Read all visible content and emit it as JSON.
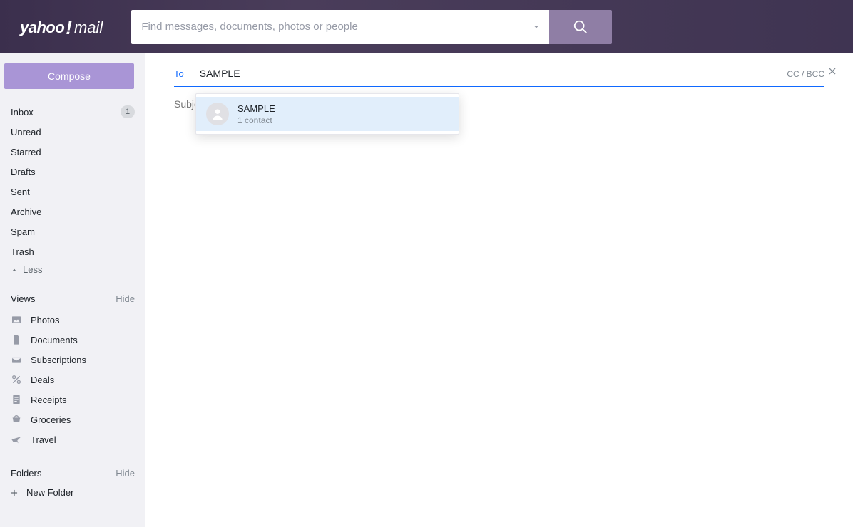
{
  "header": {
    "logo_yahoo": "yahoo",
    "logo_bang": "!",
    "logo_mail": "mail",
    "search_placeholder": "Find messages, documents, photos or people"
  },
  "sidebar": {
    "compose_label": "Compose",
    "folders": [
      {
        "label": "Inbox",
        "badge": "1"
      },
      {
        "label": "Unread"
      },
      {
        "label": "Starred"
      },
      {
        "label": "Drafts"
      },
      {
        "label": "Sent"
      },
      {
        "label": "Archive"
      },
      {
        "label": "Spam"
      },
      {
        "label": "Trash"
      }
    ],
    "less_label": "Less",
    "views_header": "Views",
    "views_hide": "Hide",
    "views": [
      {
        "label": "Photos",
        "icon": "photo-icon"
      },
      {
        "label": "Documents",
        "icon": "document-icon"
      },
      {
        "label": "Subscriptions",
        "icon": "subscriptions-icon"
      },
      {
        "label": "Deals",
        "icon": "deals-icon"
      },
      {
        "label": "Receipts",
        "icon": "receipts-icon"
      },
      {
        "label": "Groceries",
        "icon": "groceries-icon"
      },
      {
        "label": "Travel",
        "icon": "travel-icon"
      }
    ],
    "folders_header": "Folders",
    "folders_hide": "Hide",
    "new_folder_label": "New Folder"
  },
  "compose": {
    "to_label": "To",
    "to_value": "SAMPLE",
    "ccbcc_label": "CC / BCC",
    "subject_placeholder": "Subject",
    "suggestion": {
      "name": "SAMPLE",
      "sub": "1 contact"
    }
  }
}
